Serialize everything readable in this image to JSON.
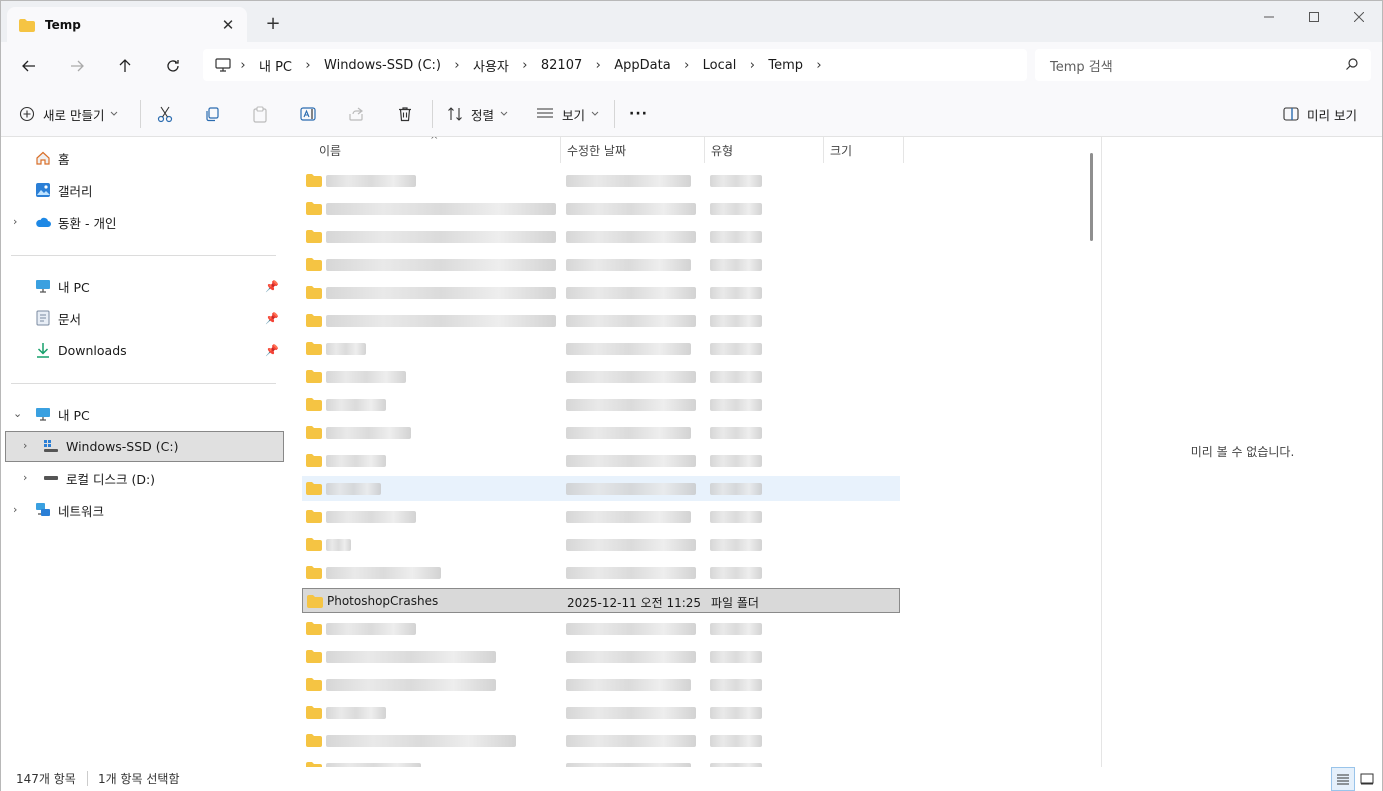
{
  "window": {
    "tab_title": "Temp",
    "tab_close": "✕",
    "new_tab": "+",
    "minimize": "—",
    "maximize": "☐",
    "close": "✕"
  },
  "address": {
    "crumbs": [
      "내 PC",
      "Windows-SSD (C:)",
      "사용자",
      "82107",
      "AppData",
      "Local",
      "Temp"
    ],
    "separator": "›",
    "search_placeholder": "Temp 검색"
  },
  "toolbar": {
    "new_label": "새로 만들기",
    "sort_label": "정렬",
    "view_label": "보기",
    "more": "···",
    "preview_label": "미리 보기"
  },
  "sidebar": {
    "home": "홈",
    "gallery": "갤러리",
    "onedrive": "동환 - 개인",
    "pinned": [
      {
        "label": "내 PC"
      },
      {
        "label": "문서"
      },
      {
        "label": "Downloads"
      }
    ],
    "thispc": "내 PC",
    "drive_c": "Windows-SSD (C:)",
    "drive_d": "로컬 디스크 (D:)",
    "network": "네트워크"
  },
  "columns": {
    "name": "이름",
    "modified": "수정한 날짜",
    "type": "유형",
    "size": "크기"
  },
  "selected_row": {
    "name": "PhotoshopCrashes",
    "modified": "2025-12-11 오전 11:25",
    "type": "파일 폴더"
  },
  "preview": {
    "message": "미리 볼 수 없습니다."
  },
  "status": {
    "count": "147개 항목",
    "selected": "1개 항목 선택함"
  },
  "colors": {
    "folder": "#f5c443",
    "accent": "#0067c0",
    "selection": "#d9d9d9"
  }
}
